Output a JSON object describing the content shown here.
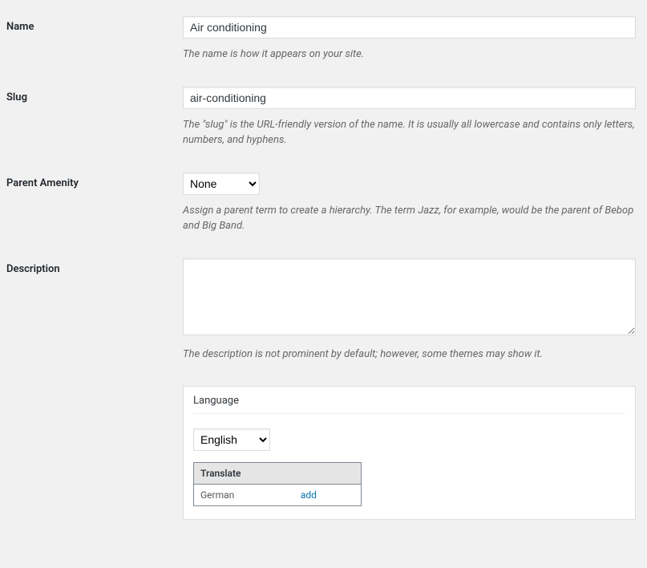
{
  "fields": {
    "name": {
      "label": "Name",
      "value": "Air conditioning",
      "description": "The name is how it appears on your site."
    },
    "slug": {
      "label": "Slug",
      "value": "air-conditioning",
      "description": "The \"slug\" is the URL-friendly version of the name. It is usually all lowercase and contains only letters, numbers, and hyphens."
    },
    "parent": {
      "label": "Parent Amenity",
      "selected": "None",
      "description": "Assign a parent term to create a hierarchy. The term Jazz, for example, would be the parent of Bebop and Big Band."
    },
    "description": {
      "label": "Description",
      "value": "",
      "description": "The description is not prominent by default; however, some themes may show it."
    }
  },
  "language_box": {
    "title": "Language",
    "selected": "English",
    "translate_header": "Translate",
    "rows": [
      {
        "language": "German",
        "action": "add"
      }
    ]
  }
}
